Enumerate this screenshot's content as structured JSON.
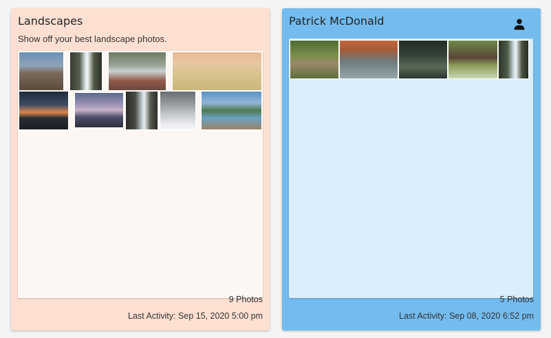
{
  "cards": [
    {
      "title": "Landscapes",
      "description": "Show off your best landscape photos.",
      "photo_count": "9 Photos",
      "last_activity": "Last Activity: Sep 15, 2020 5:00 pm",
      "background": "#fde0d2"
    },
    {
      "title": "Patrick McDonald",
      "photo_count": "5 Photos",
      "last_activity": "Last Activity: Sep 08, 2020 6:52 pm",
      "background": "#74bcef",
      "icon": "user-icon"
    }
  ]
}
